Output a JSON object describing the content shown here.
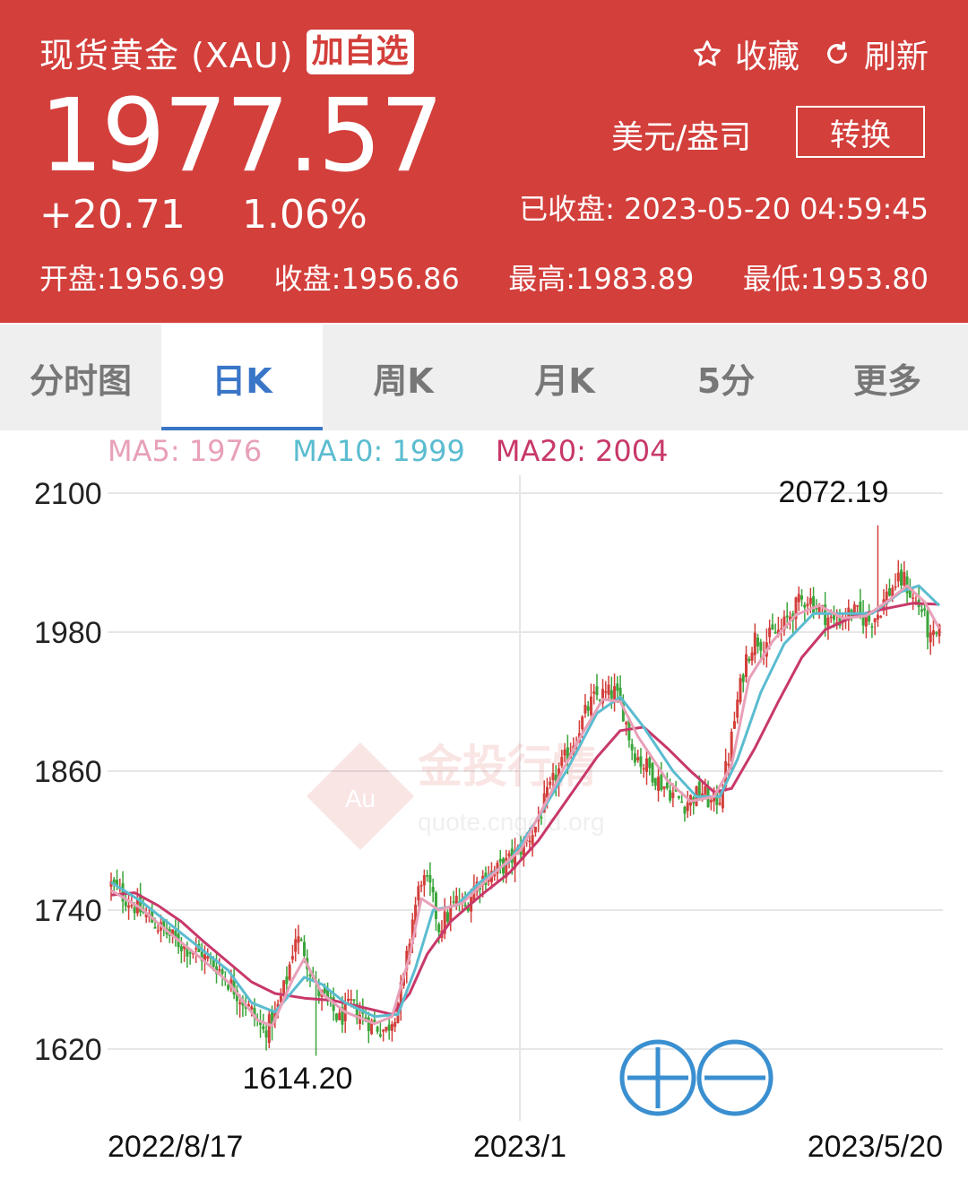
{
  "header": {
    "title": "现货黄金 (XAU)",
    "watch_label": "加自选",
    "favorite_label": "收藏",
    "refresh_label": "刷新",
    "price": "1977.57",
    "unit": "美元/盎司",
    "convert_label": "转换",
    "change": "+20.71",
    "change_pct": "1.06%",
    "close_time": "已收盘:  2023-05-20 04:59:45",
    "open": "开盘:1956.99",
    "prev_close": "收盘:1956.86",
    "high": "最高:1983.89",
    "low": "最低:1953.80",
    "bg_color": "#d33f3b"
  },
  "tabs": [
    {
      "label": "分时图",
      "active": false
    },
    {
      "label": "日K",
      "active": true
    },
    {
      "label": "周K",
      "active": false
    },
    {
      "label": "月K",
      "active": false
    },
    {
      "label": "5分",
      "active": false
    },
    {
      "label": "更多",
      "active": false
    }
  ],
  "ma_legend": {
    "ma5": "MA5: 1976",
    "ma10": "MA10: 1999",
    "ma20": "MA20: 2004",
    "ma5_color": "#e8a0b8",
    "ma10_color": "#5bbcd0",
    "ma20_color": "#c8386a"
  },
  "watermark": {
    "text": "金投行情",
    "url": "quote.cngold.org",
    "badge": "Au"
  },
  "zoom": {
    "in_icon": "zoom-in-icon",
    "out_icon": "zoom-out-icon",
    "color": "#3a8fd0"
  },
  "chart_data": {
    "type": "candlestick",
    "y_ticks": [
      2100,
      1980,
      1860,
      1740,
      1620
    ],
    "ylim": [
      1620,
      2100
    ],
    "x_tick_labels": [
      "2022/8/17",
      "2023/1",
      "2023/5/20"
    ],
    "max_label": "2072.19",
    "min_label": "1614.20",
    "up_color": "#d33f3b",
    "down_color": "#3aa53a",
    "close_path": [
      [
        0,
        1762
      ],
      [
        6,
        1748
      ],
      [
        12,
        1735
      ],
      [
        18,
        1722
      ],
      [
        24,
        1710
      ],
      [
        30,
        1702
      ],
      [
        36,
        1692
      ],
      [
        42,
        1672
      ],
      [
        48,
        1652
      ],
      [
        52,
        1635
      ],
      [
        56,
        1648
      ],
      [
        60,
        1680
      ],
      [
        63,
        1718
      ],
      [
        66,
        1705
      ],
      [
        70,
        1672
      ],
      [
        74,
        1660
      ],
      [
        78,
        1645
      ],
      [
        82,
        1658
      ],
      [
        86,
        1648
      ],
      [
        90,
        1640
      ],
      [
        94,
        1636
      ],
      [
        97,
        1652
      ],
      [
        100,
        1680
      ],
      [
        103,
        1732
      ],
      [
        106,
        1768
      ],
      [
        109,
        1758
      ],
      [
        112,
        1725
      ],
      [
        115,
        1735
      ],
      [
        118,
        1748
      ],
      [
        121,
        1742
      ],
      [
        124,
        1760
      ],
      [
        127,
        1768
      ],
      [
        130,
        1772
      ],
      [
        133,
        1776
      ],
      [
        136,
        1782
      ],
      [
        139,
        1790
      ],
      [
        142,
        1800
      ],
      [
        145,
        1812
      ],
      [
        148,
        1832
      ],
      [
        151,
        1850
      ],
      [
        154,
        1865
      ],
      [
        157,
        1880
      ],
      [
        160,
        1898
      ],
      [
        163,
        1915
      ],
      [
        166,
        1925
      ],
      [
        169,
        1926
      ],
      [
        172,
        1928
      ],
      [
        175,
        1912
      ],
      [
        178,
        1880
      ],
      [
        181,
        1868
      ],
      [
        184,
        1862
      ],
      [
        187,
        1852
      ],
      [
        190,
        1845
      ],
      [
        193,
        1838
      ],
      [
        196,
        1832
      ],
      [
        199,
        1838
      ],
      [
        202,
        1842
      ],
      [
        205,
        1832
      ],
      [
        208,
        1838
      ],
      [
        211,
        1872
      ],
      [
        214,
        1920
      ],
      [
        217,
        1958
      ],
      [
        220,
        1975
      ],
      [
        223,
        1970
      ],
      [
        226,
        1978
      ],
      [
        229,
        1982
      ],
      [
        232,
        1995
      ],
      [
        235,
        2005
      ],
      [
        238,
        2010
      ],
      [
        241,
        2002
      ],
      [
        244,
        1995
      ],
      [
        247,
        1988
      ],
      [
        250,
        1992
      ],
      [
        253,
        1998
      ],
      [
        256,
        1994
      ],
      [
        259,
        1990
      ],
      [
        262,
        1996
      ],
      [
        265,
        2012
      ],
      [
        268,
        2022
      ],
      [
        271,
        2025
      ],
      [
        274,
        2008
      ],
      [
        277,
        2000
      ],
      [
        280,
        1972
      ],
      [
        283,
        1978
      ]
    ],
    "ma5": [
      [
        0,
        1757
      ],
      [
        10,
        1742
      ],
      [
        20,
        1720
      ],
      [
        30,
        1700
      ],
      [
        40,
        1678
      ],
      [
        50,
        1645
      ],
      [
        55,
        1640
      ],
      [
        62,
        1680
      ],
      [
        66,
        1698
      ],
      [
        72,
        1668
      ],
      [
        80,
        1652
      ],
      [
        90,
        1642
      ],
      [
        96,
        1648
      ],
      [
        102,
        1700
      ],
      [
        106,
        1750
      ],
      [
        112,
        1740
      ],
      [
        120,
        1746
      ],
      [
        130,
        1770
      ],
      [
        140,
        1792
      ],
      [
        150,
        1840
      ],
      [
        160,
        1888
      ],
      [
        168,
        1922
      ],
      [
        174,
        1920
      ],
      [
        180,
        1890
      ],
      [
        190,
        1852
      ],
      [
        198,
        1834
      ],
      [
        206,
        1838
      ],
      [
        212,
        1865
      ],
      [
        218,
        1940
      ],
      [
        226,
        1972
      ],
      [
        234,
        1995
      ],
      [
        242,
        2003
      ],
      [
        250,
        1992
      ],
      [
        258,
        1994
      ],
      [
        266,
        2008
      ],
      [
        272,
        2020
      ],
      [
        278,
        2006
      ],
      [
        283,
        1983
      ]
    ],
    "ma10": [
      [
        0,
        1764
      ],
      [
        10,
        1748
      ],
      [
        20,
        1728
      ],
      [
        30,
        1708
      ],
      [
        40,
        1688
      ],
      [
        48,
        1660
      ],
      [
        56,
        1652
      ],
      [
        66,
        1682
      ],
      [
        72,
        1676
      ],
      [
        80,
        1660
      ],
      [
        90,
        1648
      ],
      [
        98,
        1650
      ],
      [
        104,
        1690
      ],
      [
        110,
        1740
      ],
      [
        118,
        1744
      ],
      [
        126,
        1764
      ],
      [
        136,
        1782
      ],
      [
        146,
        1820
      ],
      [
        156,
        1862
      ],
      [
        166,
        1910
      ],
      [
        174,
        1924
      ],
      [
        182,
        1898
      ],
      [
        192,
        1860
      ],
      [
        200,
        1838
      ],
      [
        208,
        1838
      ],
      [
        214,
        1870
      ],
      [
        222,
        1928
      ],
      [
        230,
        1970
      ],
      [
        240,
        1996
      ],
      [
        250,
        1996
      ],
      [
        260,
        1996
      ],
      [
        270,
        2015
      ],
      [
        276,
        2020
      ],
      [
        283,
        2003
      ]
    ],
    "ma20": [
      [
        0,
        1753
      ],
      [
        8,
        1755
      ],
      [
        16,
        1744
      ],
      [
        24,
        1730
      ],
      [
        32,
        1712
      ],
      [
        40,
        1695
      ],
      [
        48,
        1678
      ],
      [
        56,
        1668
      ],
      [
        66,
        1664
      ],
      [
        76,
        1662
      ],
      [
        86,
        1656
      ],
      [
        96,
        1650
      ],
      [
        102,
        1668
      ],
      [
        108,
        1702
      ],
      [
        116,
        1730
      ],
      [
        126,
        1752
      ],
      [
        136,
        1772
      ],
      [
        146,
        1800
      ],
      [
        156,
        1836
      ],
      [
        166,
        1872
      ],
      [
        174,
        1895
      ],
      [
        182,
        1898
      ],
      [
        190,
        1880
      ],
      [
        198,
        1860
      ],
      [
        206,
        1842
      ],
      [
        212,
        1845
      ],
      [
        220,
        1880
      ],
      [
        228,
        1920
      ],
      [
        236,
        1958
      ],
      [
        244,
        1982
      ],
      [
        254,
        1994
      ],
      [
        264,
        2000
      ],
      [
        274,
        2005
      ],
      [
        283,
        2004
      ]
    ]
  }
}
